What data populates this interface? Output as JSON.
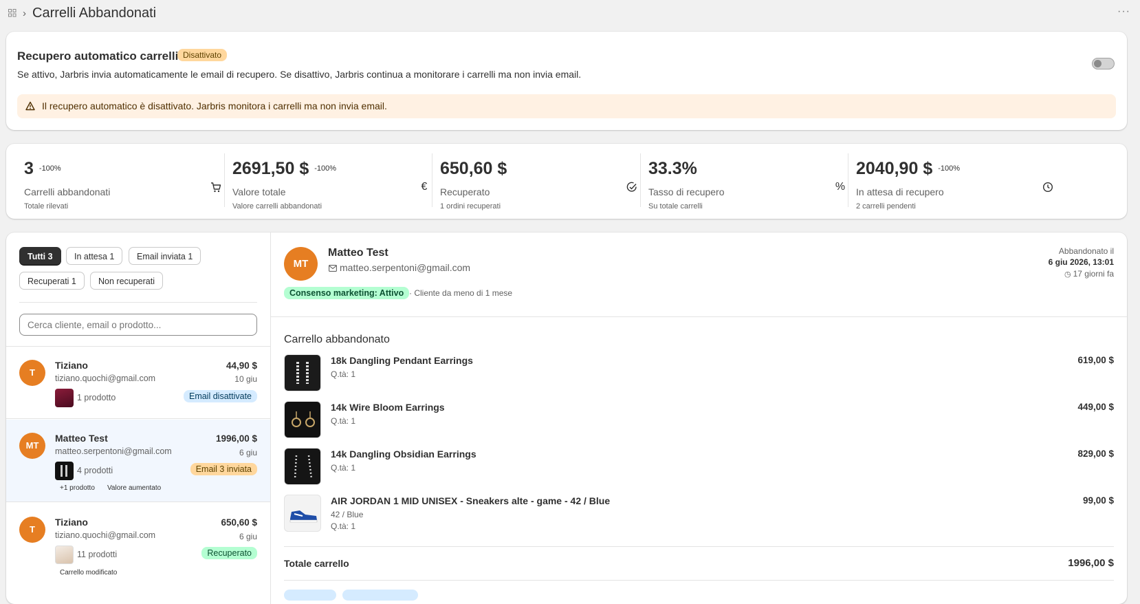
{
  "breadcrumb": {
    "title": "Carrelli Abbandonati",
    "more": "···"
  },
  "recovery": {
    "title": "Recupero automatico carrelli",
    "status_badge": "Disattivato",
    "description": "Se attivo, Jarbris invia automaticamente le email di recupero. Se disattivo, Jarbris continua a monitorare i carrelli ma non invia email.",
    "toggle_on": false,
    "warning": "Il recupero automatico è disattivato. Jarbris monitora i carrelli ma non invia email."
  },
  "stats": [
    {
      "value": "3",
      "change": "-100%",
      "label": "Carrelli abbandonati",
      "sub": "Totale rilevati",
      "icon": "cart-icon"
    },
    {
      "value": "2691,50 $",
      "change": "-100%",
      "label": "Valore totale",
      "sub": "Valore carrelli abbandonati",
      "icon": "euro-icon"
    },
    {
      "value": "650,60 $",
      "change": "",
      "label": "Recuperato",
      "sub": "1 ordini recuperati",
      "icon": "check-circle-icon"
    },
    {
      "value": "33.3%",
      "change": "",
      "label": "Tasso di recupero",
      "sub": "Su totale carrelli",
      "icon": "percent-icon"
    },
    {
      "value": "2040,90 $",
      "change": "-100%",
      "label": "In attesa di recupero",
      "sub": "2 carrelli pendenti",
      "icon": "clock-icon"
    }
  ],
  "filters": {
    "all": "Tutti 3",
    "waiting": "In attesa 1",
    "email_sent": "Email inviata 1",
    "recovered": "Recuperati 1",
    "not_recovered": "Non recuperati"
  },
  "search": {
    "placeholder": "Cerca cliente, email o prodotto..."
  },
  "carts": [
    {
      "initials": "T",
      "name": "Tiziano",
      "email": "tiziano.quochi@gmail.com",
      "amount": "44,90 $",
      "date": "10 giu",
      "products": "1 prodotto",
      "status": "Email disattivate"
    },
    {
      "initials": "MT",
      "name": "Matteo Test",
      "email": "matteo.serpentoni@gmail.com",
      "amount": "1996,00 $",
      "date": "6 giu",
      "products": "4 prodotti",
      "status": "Email 3 inviata",
      "note1": "+1 prodotto",
      "note2": "Valore aumentato"
    },
    {
      "initials": "T",
      "name": "Tiziano",
      "email": "tiziano.quochi@gmail.com",
      "amount": "650,60 $",
      "date": "6 giu",
      "products": "11 prodotti",
      "status": "Recuperato",
      "note1": "Carrello modificato"
    }
  ],
  "detail": {
    "initials": "MT",
    "name": "Matteo Test",
    "email": "matteo.serpentoni@gmail.com",
    "consent": "Consenso marketing: Attivo",
    "since": "· Cliente da meno di 1 mese",
    "abandoned_label": "Abbandonato il",
    "abandoned_date": "6 giu 2026, 13:01",
    "abandoned_ago": "17 giorni fa",
    "section_title": "Carrello abbandonato",
    "items": [
      {
        "name": "18k Dangling Pendant Earrings",
        "qty": "Q.tà: 1",
        "variant": "",
        "price": "619,00 $"
      },
      {
        "name": "14k Wire Bloom Earrings",
        "qty": "Q.tà: 1",
        "variant": "",
        "price": "449,00 $"
      },
      {
        "name": "14k Dangling Obsidian Earrings",
        "qty": "Q.tà: 1",
        "variant": "",
        "price": "829,00 $"
      },
      {
        "name": "AIR JORDAN 1 MID UNISEX - Sneakers alte - game - 42 / Blue",
        "qty": "Q.tà: 1",
        "variant": "42 / Blue",
        "price": "99,00 $"
      }
    ],
    "total_label": "Totale carrello",
    "total_value": "1996,00 $"
  },
  "colors": {
    "avatar": "#e67e22",
    "warning_bg": "#fff1e3",
    "selected_row": "#f2f7fe"
  }
}
